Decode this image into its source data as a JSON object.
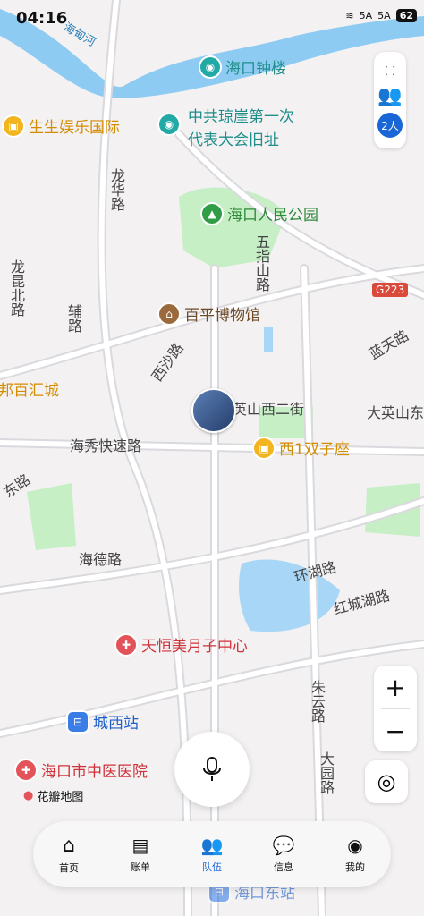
{
  "status": {
    "time": "04:16",
    "signal1": "5A",
    "signal2": "5A",
    "battery": "62"
  },
  "map": {
    "rivers": [
      "海甸河"
    ],
    "pois": [
      {
        "name": "海口钟楼",
        "color": "#21a9a6"
      },
      {
        "name": "生生娱乐国际",
        "color": "#f2b51f",
        "text": "#d48c00"
      },
      {
        "name": "中共琼崖第一次",
        "name2": "代表大会旧址",
        "color": "#21a9a6"
      },
      {
        "name": "海口人民公园",
        "color": "#2f9e44"
      },
      {
        "name": "百平博物馆",
        "color": "#9b6a3c"
      },
      {
        "name": "西1双子座",
        "color": "#f2b51f",
        "text": "#d48c00"
      },
      {
        "name": "天恒美月子中心",
        "color": "#e2535a",
        "text": "#d0323a"
      },
      {
        "name": "城西站",
        "color": "#3b7de6",
        "text": "#1d5fc9"
      },
      {
        "name": "海口市中医医院",
        "color": "#e2535a",
        "text": "#d0323a"
      },
      {
        "name": "海口东站",
        "color": "#3b7de6"
      },
      {
        "name": "邦百汇城",
        "text": "#d48c00"
      }
    ],
    "roads": [
      "龙华路",
      "龙昆北路",
      "辅路",
      "五指山路",
      "西沙路",
      "蓝天路",
      "英山西二街",
      "大英山东",
      "海秀快速路",
      "东路",
      "海德路",
      "环湖路",
      "红城湖路",
      "朱云路",
      "大园路",
      "G223"
    ],
    "watermark": "花瓣地图"
  },
  "team": {
    "count_label": "2人"
  },
  "nav": [
    {
      "label": "首页",
      "icon": "home-icon"
    },
    {
      "label": "账单",
      "icon": "bill-icon"
    },
    {
      "label": "队伍",
      "icon": "team-icon",
      "active": true
    },
    {
      "label": "信息",
      "icon": "message-icon"
    },
    {
      "label": "我的",
      "icon": "profile-icon"
    }
  ],
  "controls": {
    "zoom_in": "+",
    "zoom_out": "−"
  }
}
